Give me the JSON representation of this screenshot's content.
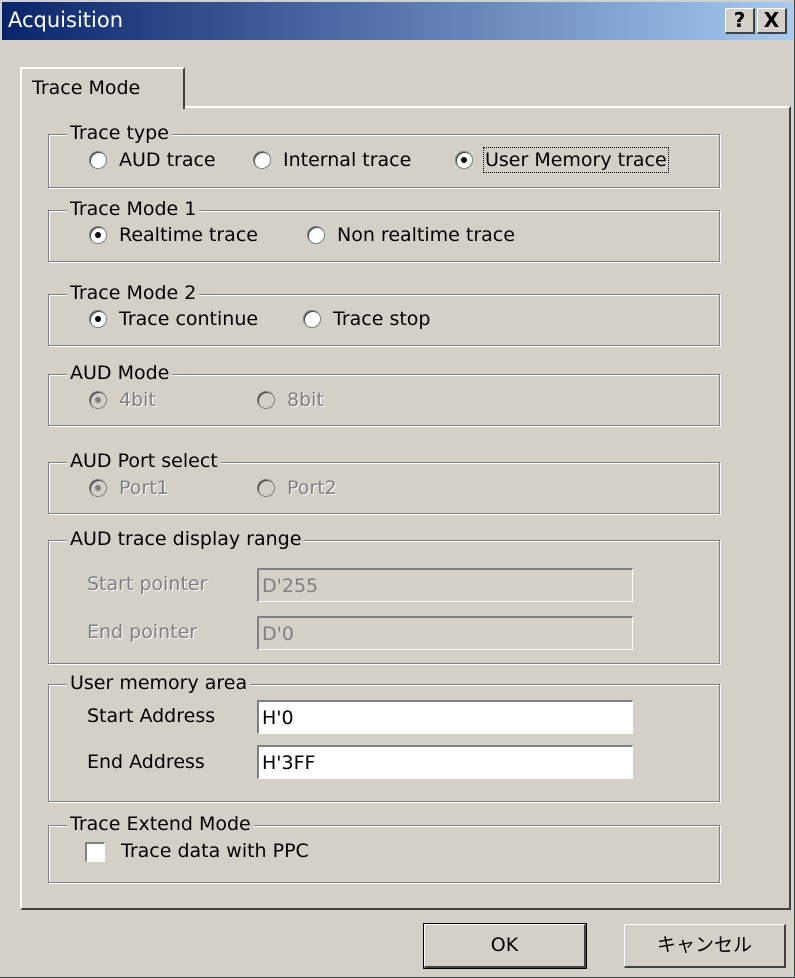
{
  "window": {
    "title": "Acquisition",
    "help_label": "?",
    "close_label": "X"
  },
  "tab": {
    "label": "Trace Mode"
  },
  "trace_type": {
    "legend": "Trace type",
    "options": [
      {
        "label": "AUD trace",
        "checked": false
      },
      {
        "label": "Internal trace",
        "checked": false
      },
      {
        "label": "User Memory trace",
        "checked": true
      }
    ]
  },
  "trace_mode_1": {
    "legend": "Trace Mode 1",
    "options": [
      {
        "label": "Realtime trace",
        "checked": true
      },
      {
        "label": "Non realtime trace",
        "checked": false
      }
    ]
  },
  "trace_mode_2": {
    "legend": "Trace Mode 2",
    "options": [
      {
        "label": "Trace continue",
        "checked": true
      },
      {
        "label": "Trace stop",
        "checked": false
      }
    ]
  },
  "aud_mode": {
    "legend": "AUD Mode",
    "disabled": true,
    "options": [
      {
        "label": "4bit",
        "checked": true
      },
      {
        "label": "8bit",
        "checked": false
      }
    ]
  },
  "aud_port": {
    "legend": "AUD Port select",
    "disabled": true,
    "options": [
      {
        "label": "Port1",
        "checked": true
      },
      {
        "label": "Port2",
        "checked": false
      }
    ]
  },
  "aud_range": {
    "legend": "AUD trace display range",
    "disabled": true,
    "start_label": "Start pointer",
    "start_value": "D'255",
    "end_label": "End pointer",
    "end_value": "D'0"
  },
  "user_memory": {
    "legend": "User memory area",
    "start_label": "Start Address",
    "start_value": "H'0",
    "end_label": "End Address",
    "end_value": "H'3FF"
  },
  "extend_mode": {
    "legend": "Trace Extend Mode",
    "checkbox_label": "Trace data with PPC",
    "checked": false
  },
  "buttons": {
    "ok": "OK",
    "cancel": "キャンセル"
  },
  "colors": {
    "face": "#d4d0c8",
    "title_start": "#0a246a",
    "title_end": "#a6caf0"
  }
}
